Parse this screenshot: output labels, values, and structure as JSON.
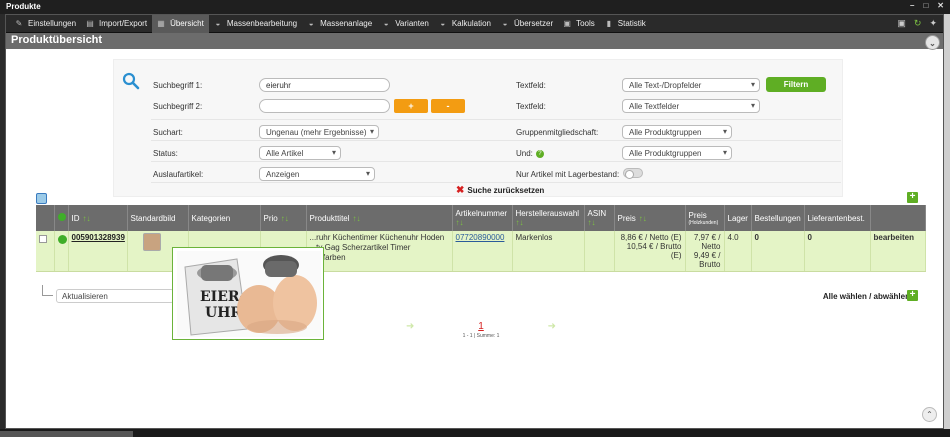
{
  "window": {
    "title": "Produkte"
  },
  "menu": {
    "items": [
      {
        "label": "Einstellungen",
        "icon": "wrench-icon"
      },
      {
        "label": "Import/Export",
        "icon": "document-icon"
      },
      {
        "label": "Übersicht",
        "icon": "grid-icon",
        "active": true
      },
      {
        "label": "Massenbearbeitung",
        "icon": "basket-icon"
      },
      {
        "label": "Massenanlage",
        "icon": "basket-icon"
      },
      {
        "label": "Varianten",
        "icon": "basket-icon"
      },
      {
        "label": "Kalkulation",
        "icon": "basket-icon"
      },
      {
        "label": "Übersetzer",
        "icon": "basket-icon"
      },
      {
        "label": "Tools",
        "icon": "toolbox-icon"
      },
      {
        "label": "Statistik",
        "icon": "battery-icon"
      }
    ]
  },
  "page": {
    "title": "Produktübersicht"
  },
  "filter": {
    "suchbegriff1_label": "Suchbegriff 1:",
    "suchbegriff1_value": "eieruhr",
    "suchbegriff2_label": "Suchbegriff 2:",
    "plus_label": "+",
    "minus_label": "-",
    "textfeld1_label": "Textfeld:",
    "textfeld1_value": "Alle Text-/Dropfelder",
    "textfeld2_label": "Textfeld:",
    "textfeld2_value": "Alle Textfelder",
    "filter_button": "Filtern",
    "suchart_label": "Suchart:",
    "suchart_value": "Ungenau (mehr Ergebnisse)",
    "status_label": "Status:",
    "status_value": "Alle Artikel",
    "auslauf_label": "Auslaufartikel:",
    "auslauf_value": "Anzeigen",
    "gruppe_label": "Gruppenmitgliedschaft:",
    "gruppe_value": "Alle Produktgruppen",
    "und_label": "Und:",
    "und_value": "Alle Produktgruppen",
    "lager_label": "Nur Artikel mit Lagerbestand:",
    "reset_label": "Suche zurücksetzen"
  },
  "table": {
    "headers": {
      "id": "ID",
      "standardbild": "Standardbild",
      "kategorien": "Kategorien",
      "prio": "Prio",
      "produkttitel": "Produkttitel",
      "artikelnummer": "Artikelnummer",
      "herstellerauswahl": "Herstellerauswahl",
      "asin": "ASIN",
      "preis": "Preis",
      "preis_hk": "Preis",
      "preis_hk_sub": "(Holzkunden)",
      "lager": "Lager",
      "bestellungen": "Bestellungen",
      "lieferantenbest": "Lieferantenbest."
    },
    "rows": [
      {
        "id": "005901328939",
        "produkttitel": "...ruhr Küchentimer Küchenuhr Hoden ...ty Gag Scherzartikel Timer ...utfarben",
        "artikelnummer": "07720890000",
        "hersteller": "Markenlos",
        "asin": "",
        "preis_netto": "8,86 € / Netto (E)",
        "preis_brutto": "10,54 € / Brutto (E)",
        "preis_hk": "7,97 € / Netto 9,49 € / Brutto",
        "lager": "4.0",
        "bestellungen": "0",
        "lieferantenbest": "0",
        "action": "bearbeiten"
      }
    ]
  },
  "popup": {
    "image_text_line1": "EIER-",
    "image_text_line2": "UHR"
  },
  "bulk": {
    "action_value": "Aktualisieren",
    "select_all": "Alle wählen / abwählen"
  },
  "pager": {
    "current_page": "1",
    "summary": "1 - 1 | Summe: 1"
  }
}
